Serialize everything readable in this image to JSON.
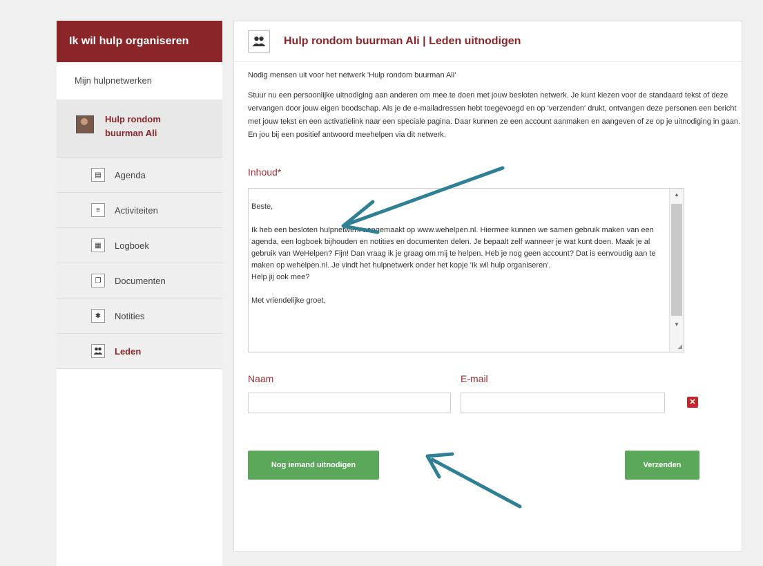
{
  "sidebar": {
    "header": "Ik wil hulp organiseren",
    "nav_top": "Mijn hulpnetwerken",
    "network": {
      "label": "Hulp rondom buurman Ali"
    },
    "items": [
      {
        "label": "Agenda",
        "icon": "calendar-icon",
        "glyph": "▤"
      },
      {
        "label": "Activiteiten",
        "icon": "list-icon",
        "glyph": "≡"
      },
      {
        "label": "Logboek",
        "icon": "book-icon",
        "glyph": "▦"
      },
      {
        "label": "Documenten",
        "icon": "documents-icon",
        "glyph": "❐"
      },
      {
        "label": "Notities",
        "icon": "pin-icon",
        "glyph": "✱"
      },
      {
        "label": "Leden",
        "icon": "members-icon",
        "glyph": "👥"
      }
    ]
  },
  "main": {
    "title": "Hulp rondom buurman Ali | Leden uitnodigen",
    "intro": "Nodig mensen uit voor het netwerk 'Hulp rondom buurman Ali'",
    "description": "Stuur nu een persoonlijke uitnodiging aan anderen om mee te doen met jouw besloten netwerk. Je kunt kiezen voor de standaard tekst of deze vervangen door jouw eigen boodschap. Als je de e-mailadressen hebt toegevoegd en op 'verzenden' drukt, ontvangen deze personen een bericht met jouw tekst en een activatielink naar een speciale pagina. Daar kunnen ze een account aanmaken en aangeven of ze op je uitnodiging in gaan. En jou bij een positief antwoord meehelpen via dit netwerk.",
    "content_label": "Inhoud*",
    "message": "Beste,\n\nIk heb een besloten hulpnetwerk aangemaakt op www.wehelpen.nl. Hiermee kunnen we samen gebruik maken van een agenda, een logboek bijhouden en notities en documenten delen. Je bepaalt zelf wanneer je wat kunt doen. Maak je al gebruik van WeHelpen? Fijn! Dan vraag ik je graag om mij te helpen. Heb je nog geen account? Dat is eenvoudig aan te maken op wehelpen.nl. Je vindt het hulpnetwerk onder het kopje 'Ik wil hulp organiseren'.\nHelp jij ook mee?\n\nMet vriendelijke groet,",
    "name_label": "Naam",
    "email_label": "E-mail",
    "name_value": "",
    "email_value": "",
    "remove_glyph": "✕",
    "invite_button": "Nog iemand uitnodigen",
    "send_button": "Verzenden"
  },
  "colors": {
    "brand": "#8a2529",
    "button_green": "#5ba85b",
    "annotation_arrow": "#2f7f95",
    "remove_red": "#c0282d"
  }
}
